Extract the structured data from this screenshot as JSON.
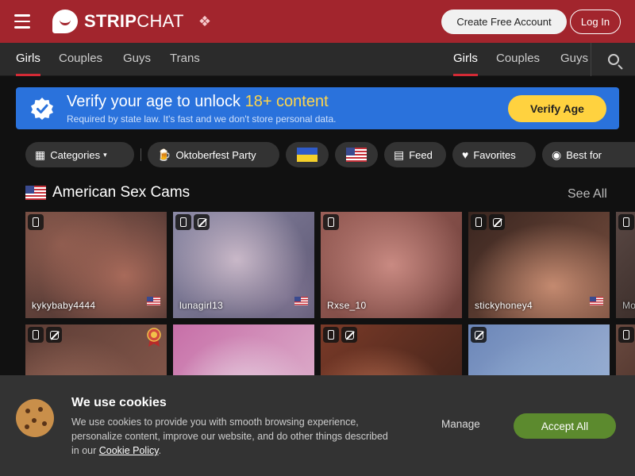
{
  "header": {
    "brand_bold": "STRIP",
    "brand_light": "CHAT",
    "create_account_label": "Create Free Account",
    "login_label": "Log In"
  },
  "nav": {
    "left": [
      "Girls",
      "Couples",
      "Guys",
      "Trans"
    ],
    "right": [
      "Girls",
      "Couples",
      "Guys"
    ]
  },
  "verify": {
    "title_prefix": "Verify your age to unlock ",
    "title_highlight": "18+ content",
    "subtitle": "Required by state law. It's fast and we don't store personal data.",
    "button": "Verify Age"
  },
  "filters": {
    "categories": "Categories",
    "oktoberfest": "Oktoberfest Party",
    "feed": "Feed",
    "favorites": "Favorites",
    "best_for": "Best for"
  },
  "section": {
    "title": "American Sex Cams",
    "see_all": "See All"
  },
  "cards_row1": [
    {
      "name": "kykybaby4444"
    },
    {
      "name": "lunagirl13"
    },
    {
      "name": "Rxse_10"
    },
    {
      "name": "stickyhoney4"
    },
    {
      "name": "Mo"
    }
  ],
  "cookie": {
    "title": "We use cookies",
    "text": "We use cookies to provide you with smooth browsing experience, personalize content, improve our website, and do other things described in our ",
    "link": "Cookie Policy",
    "manage": "Manage",
    "accept": "Accept All"
  },
  "colors": {
    "brand_red": "#a2252d",
    "verify_blue": "#2a72dc",
    "verify_yellow": "#ffd23f",
    "accept_green": "#5c8a2e"
  }
}
